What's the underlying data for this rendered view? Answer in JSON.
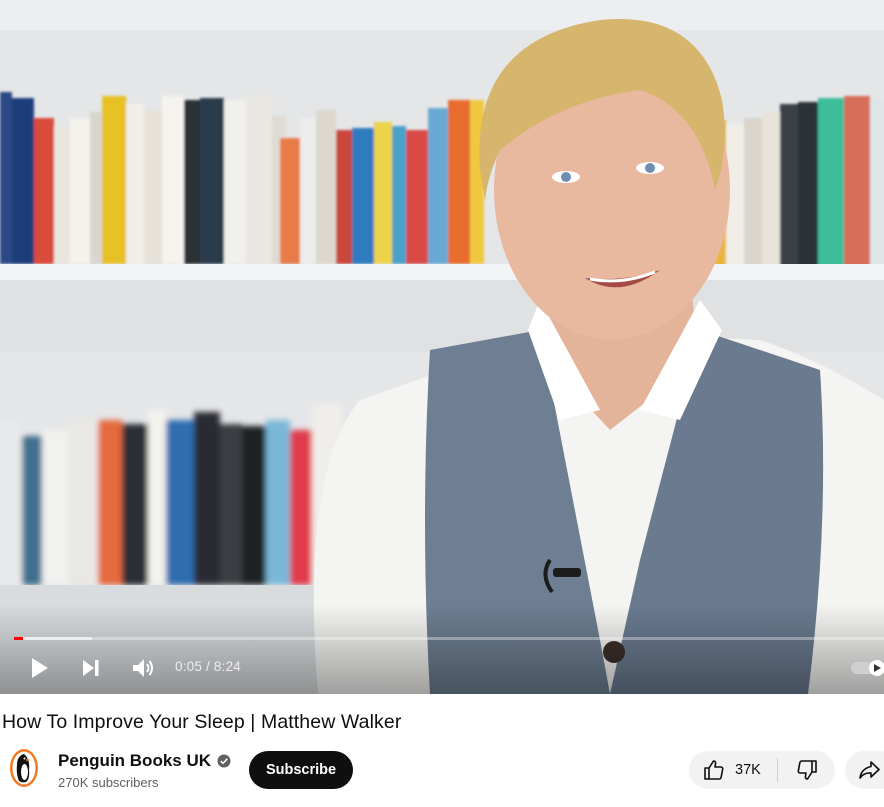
{
  "video": {
    "current_time": "0:05",
    "duration": "8:24",
    "time_display": "0:05 / 8:24",
    "progress_played": 0.0099,
    "progress_buffered": 0.09
  },
  "title": "How To Improve Your Sleep | Matthew Walker",
  "channel": {
    "name": "Penguin Books UK",
    "verified": true,
    "subscribers": "270K subscribers"
  },
  "actions": {
    "subscribe_label": "Subscribe",
    "like_count": "37K"
  },
  "icons": {
    "play": "play-icon",
    "next": "next-icon",
    "volume": "volume-icon",
    "autoplay": "autoplay-toggle-icon",
    "verified": "verified-check-icon",
    "like": "thumbs-up-icon",
    "dislike": "thumbs-down-icon",
    "share": "share-icon",
    "avatar": "penguin-logo-icon"
  },
  "colors": {
    "progress": "#ff0000",
    "subscribe_bg": "#0f0f0f",
    "pill_bg": "#f2f2f2"
  }
}
